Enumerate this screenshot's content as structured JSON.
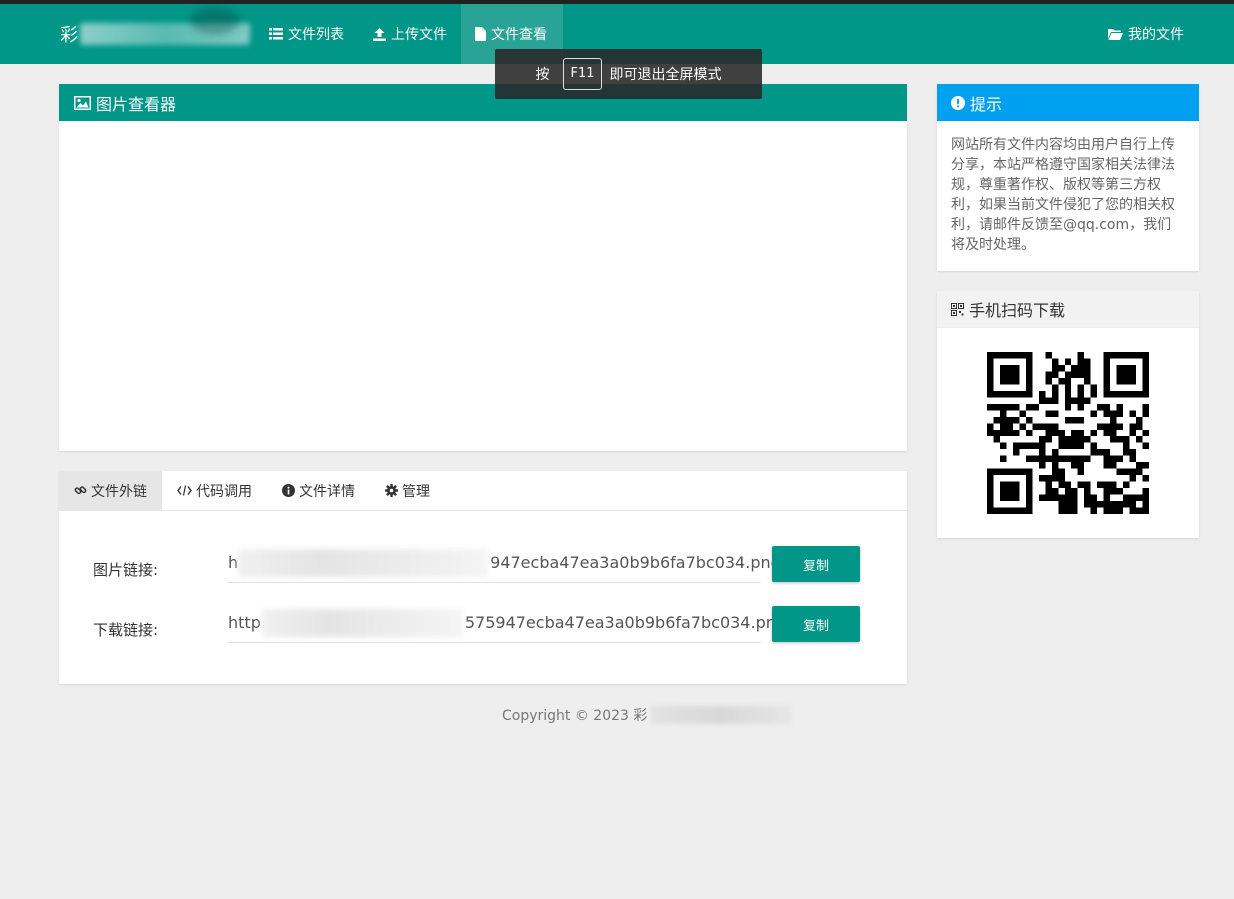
{
  "brand": {
    "initial": "彩"
  },
  "nav": {
    "file_list": "文件列表",
    "upload": "上传文件",
    "view": "文件查看",
    "my_files": "我的文件"
  },
  "toast": {
    "prefix": "按",
    "key": "F11",
    "suffix": "即可退出全屏模式"
  },
  "viewer": {
    "title": "图片查看器"
  },
  "tabs": [
    "文件外链",
    "代码调用",
    "文件详情",
    "管理"
  ],
  "links": {
    "image": {
      "label": "图片链接:",
      "value": "h947ecba47ea3a0b9b6fa7bc034.png",
      "visible_start": "h",
      "visible_end": "947ecba47ea3a0b9b6fa7bc034.png",
      "button": "复制"
    },
    "download": {
      "label": "下载链接:",
      "value": "http575947ecba47ea3a0b9b6fa7bc034.png",
      "visible_start": "http",
      "visible_end": "575947ecba47ea3a0b9b6fa7bc034.png",
      "button": "复制"
    }
  },
  "footer": {
    "copyright": "Copyright © 2023 彩"
  },
  "notice": {
    "title": "提示",
    "body": "网站所有文件内容均由用户自行上传分享，本站严格遵守国家相关法律法规，尊重著作权、版权等第三方权利，如果当前文件侵犯了您的相关权利，请邮件反馈至@qq.com，我们将及时处理。"
  },
  "qr": {
    "title": "手机扫码下载"
  },
  "colors": {
    "primary": "#009688",
    "info": "#00a0f0",
    "background": "#eeeeee"
  }
}
